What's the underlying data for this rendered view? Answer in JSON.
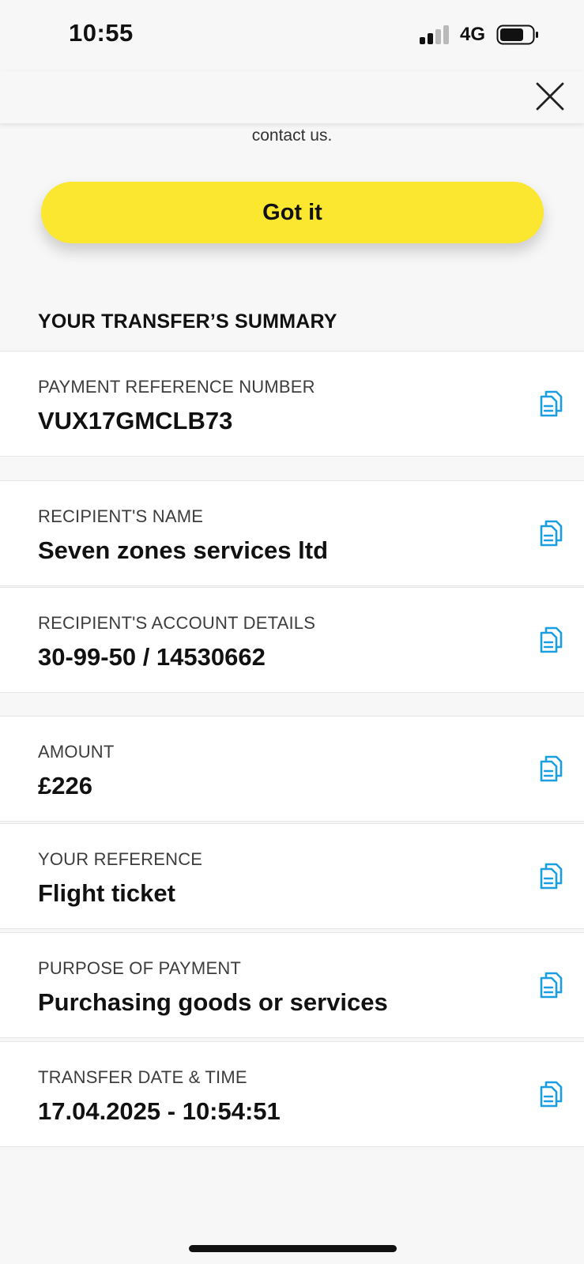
{
  "status_bar": {
    "time": "10:55",
    "network": "4G"
  },
  "notice": {
    "visible_text": "contact us."
  },
  "actions": {
    "got_it_label": "Got it"
  },
  "summary": {
    "heading": "YOUR TRANSFER’S SUMMARY",
    "items": [
      {
        "label": "PAYMENT REFERENCE NUMBER",
        "value": "VUX17GMCLB73"
      },
      {
        "label": "RECIPIENT'S NAME",
        "value": "Seven zones services ltd"
      },
      {
        "label": "RECIPIENT'S ACCOUNT DETAILS",
        "value": "30-99-50 / 14530662"
      },
      {
        "label": "AMOUNT",
        "value": "£226"
      },
      {
        "label": "YOUR REFERENCE",
        "value": "Flight ticket"
      },
      {
        "label": "PURPOSE OF PAYMENT",
        "value": "Purchasing goods or services"
      },
      {
        "label": "TRANSFER DATE & TIME",
        "value": "17.04.2025 - 10:54:51"
      }
    ]
  },
  "colors": {
    "accent_yellow": "#fbe72f",
    "copy_icon_blue": "#1a9ee2",
    "background": "#f7f7f7"
  },
  "icons": {
    "close": "close-icon",
    "copy": "copy-icon"
  }
}
